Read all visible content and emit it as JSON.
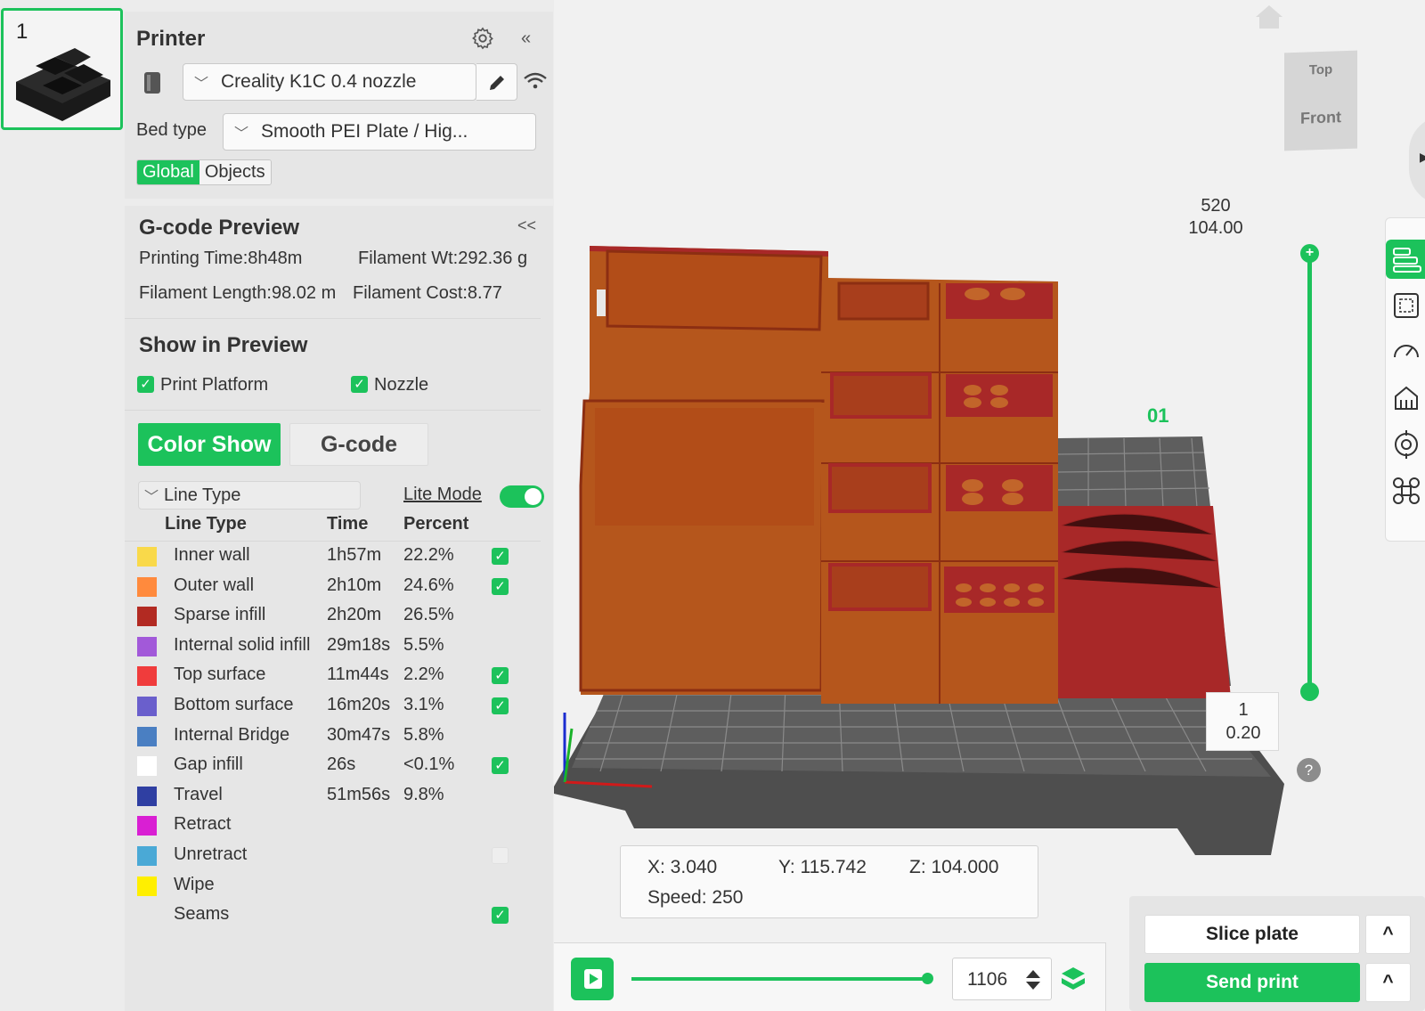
{
  "plate": {
    "number": "1"
  },
  "printer": {
    "title": "Printer",
    "collapse": "«",
    "printer_name": "Creality K1C 0.4 nozzle",
    "bed_type_label": "Bed type",
    "bed_type_value": "Smooth PEI Plate / Hig...",
    "tabs": [
      "Global",
      "Objects"
    ]
  },
  "gcode_preview": {
    "title": "G-code Preview",
    "collapse": "<<",
    "printing_time": "Printing Time:8h48m",
    "filament_wt": "Filament Wt:292.36 g",
    "filament_length": "Filament Length:98.02 m",
    "filament_cost": "Filament Cost:8.77"
  },
  "show_in_preview": {
    "title": "Show in Preview",
    "options": [
      {
        "label": "Print Platform",
        "checked": true
      },
      {
        "label": "Nozzle",
        "checked": true
      }
    ]
  },
  "view_tabs": {
    "color_show": "Color Show",
    "gcode": "G-code"
  },
  "line_type": {
    "dropdown_label": "Line Type",
    "lite_mode_label": "Lite Mode",
    "lite_mode_on": true,
    "columns": [
      "Line Type",
      "Time",
      "Percent"
    ],
    "rows": [
      {
        "color": "#f9d94a",
        "name": "Inner wall",
        "time": "1h57m",
        "percent": "22.2%",
        "checked": true
      },
      {
        "color": "#ff8a3d",
        "name": "Outer wall",
        "time": "2h10m",
        "percent": "24.6%",
        "checked": true
      },
      {
        "color": "#b22a22",
        "name": "Sparse infill",
        "time": "2h20m",
        "percent": "26.5%",
        "checked": null
      },
      {
        "color": "#a259d9",
        "name": "Internal solid infill",
        "time": "29m18s",
        "percent": "5.5%",
        "checked": null
      },
      {
        "color": "#f03c3c",
        "name": "Top surface",
        "time": "11m44s",
        "percent": "2.2%",
        "checked": true
      },
      {
        "color": "#6a5fcc",
        "name": "Bottom surface",
        "time": "16m20s",
        "percent": "3.1%",
        "checked": true
      },
      {
        "color": "#4a7fc2",
        "name": "Internal Bridge",
        "time": "30m47s",
        "percent": "5.8%",
        "checked": null
      },
      {
        "color": "#ffffff",
        "name": "Gap infill",
        "time": "26s",
        "percent": "<0.1%",
        "checked": true
      },
      {
        "color": "#2f3fa2",
        "name": "Travel",
        "time": "51m56s",
        "percent": "9.8%",
        "checked": null
      },
      {
        "color": "#d91fd3",
        "name": "Retract",
        "time": "",
        "percent": "",
        "checked": null
      },
      {
        "color": "#4aa9d6",
        "name": "Unretract",
        "time": "",
        "percent": "",
        "checked": false
      },
      {
        "color": "#ffef00",
        "name": "Wipe",
        "time": "",
        "percent": "",
        "checked": null
      },
      {
        "color": "",
        "name": "Seams",
        "time": "",
        "percent": "",
        "checked": true
      }
    ]
  },
  "viewport": {
    "view_cube_top": "Top",
    "view_cube_front": "Front",
    "plate_label": "01",
    "layer_top_number": "520",
    "layer_top_height": "104.00",
    "layer_bottom_number": "1",
    "layer_bottom_height": "0.20",
    "layer_range_fraction": [
      0,
      1
    ],
    "help": "?"
  },
  "coords": {
    "x": "X: 3.040",
    "y": "Y: 115.742",
    "z": "Z: 104.000",
    "speed": "Speed: 250"
  },
  "playback": {
    "move_value": "1106",
    "progress_fraction": 1.0
  },
  "actions": {
    "slice_plate": "Slice plate",
    "send_print": "Send print",
    "expand": "^"
  },
  "colors": {
    "accent": "#1cc25b",
    "model": "#b5561c",
    "infill": "#a52424",
    "bed": "#5e5e5e"
  }
}
